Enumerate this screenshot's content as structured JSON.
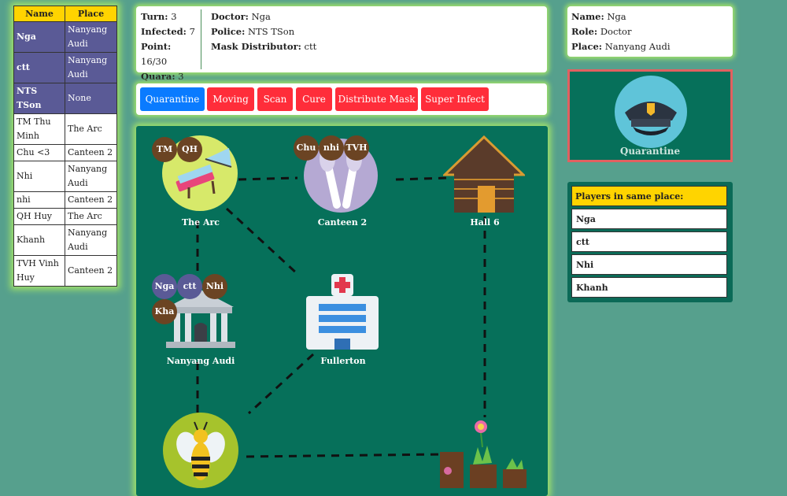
{
  "players_table": {
    "headers": {
      "name": "Name",
      "place": "Place"
    },
    "rows": [
      {
        "name": "Nga",
        "place": "Nanyang Audi",
        "highlight": true
      },
      {
        "name": "ctt",
        "place": "Nanyang Audi",
        "highlight": true
      },
      {
        "name": "NTS TSon",
        "place": "None",
        "highlight": true
      },
      {
        "name": "TM Thu Minh",
        "place": "The Arc",
        "highlight": false
      },
      {
        "name": "Chu <3",
        "place": "Canteen 2",
        "highlight": false
      },
      {
        "name": "Nhi",
        "place": "Nanyang Audi",
        "highlight": false
      },
      {
        "name": "nhi",
        "place": "Canteen 2",
        "highlight": false
      },
      {
        "name": "QH Huy",
        "place": "The Arc",
        "highlight": false
      },
      {
        "name": "Khanh",
        "place": "Nanyang Audi",
        "highlight": false
      },
      {
        "name": "TVH Vinh Huy",
        "place": "Canteen 2",
        "highlight": false
      }
    ]
  },
  "status": {
    "turn_label": "Turn:",
    "turn": "3",
    "infected_label": "Infected:",
    "infected": "7",
    "point_label": "Point:",
    "point": "16/30",
    "quara_label": "Quara:",
    "quara": "3",
    "doctor_label": "Doctor:",
    "doctor": "Nga",
    "police_label": "Police:",
    "police": "NTS TSon",
    "mask_label": "Mask Distributor:",
    "mask": "ctt"
  },
  "actions": {
    "quarantine": "Quarantine",
    "moving": "Moving",
    "scan": "Scan",
    "cure": "Cure",
    "distribute_mask": "Distribute Mask",
    "super_infect": "Super Infect"
  },
  "places": {
    "the_arc": {
      "label": "The Arc",
      "tokens": [
        "TM",
        "QH"
      ]
    },
    "canteen2": {
      "label": "Canteen 2",
      "tokens": [
        "Chu",
        "nhi",
        "TVH"
      ]
    },
    "hall6": {
      "label": "Hall 6",
      "tokens": []
    },
    "nanyang_audi": {
      "label": "Nanyang Audi",
      "tokens": [
        "Nga",
        "ctt",
        "Nhi",
        "Kha"
      ]
    },
    "fullerton": {
      "label": "Fullerton",
      "tokens": []
    }
  },
  "info": {
    "name_label": "Name:",
    "name": "Nga",
    "role_label": "Role:",
    "role": "Doctor",
    "place_label": "Place:",
    "place": "Nanyang Audi"
  },
  "role_card": {
    "label": "Quarantine",
    "icon": "police-cap-icon"
  },
  "same_place": {
    "header": "Players in same place:",
    "players": [
      "Nga",
      "ctt",
      "Nhi",
      "Khanh"
    ]
  },
  "colors": {
    "background": "#56a08d",
    "board": "#06705a",
    "glow": "#9fe06a",
    "header_yellow": "#ffd400",
    "highlight_row": "#5a5a96",
    "button_blue": "#0a7bff",
    "button_red": "#ff2d3a"
  }
}
